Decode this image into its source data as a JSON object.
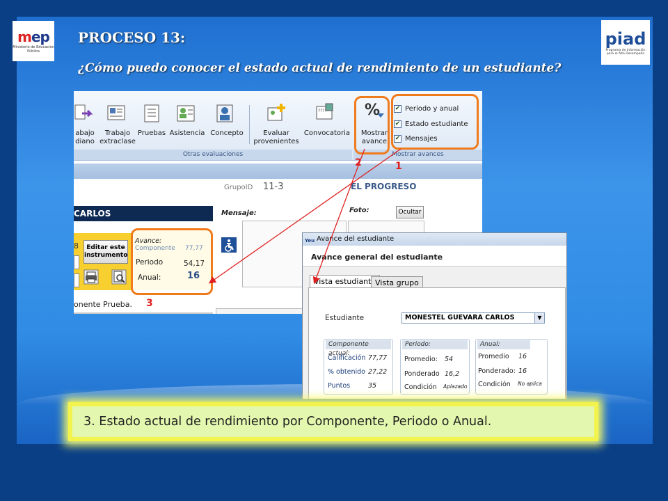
{
  "header": {
    "title": "PROCESO 13:",
    "subtitle": "¿Cómo  puedo conocer el estado actual de rendimiento  de un estudiante?"
  },
  "logos": {
    "mep": {
      "text_a": "m",
      "text_b": "e",
      "text_c": "p",
      "caption": "Ministerio de Educación Pública"
    },
    "piad": {
      "text": "piad",
      "caption": "Programa de Información para el Alto Desempeño"
    }
  },
  "ribbon": {
    "buttons": [
      {
        "label": "abajo\ndiano"
      },
      {
        "label": "Trabajo\nextraclase"
      },
      {
        "label": "Pruebas"
      },
      {
        "label": "Asistencia"
      },
      {
        "label": "Concepto"
      },
      {
        "label": "Evaluar\nprovenientes"
      },
      {
        "label": "Convocatoria"
      },
      {
        "label": "Mostrar\navance"
      }
    ],
    "groups": {
      "otras": "Otras evaluaciones",
      "mostrar": "Mostrar avances"
    },
    "checkboxes": [
      {
        "label": "Periodo y anual",
        "checked": true
      },
      {
        "label": "Estado estudiante",
        "checked": true
      },
      {
        "label": "Mensajes",
        "checked": true
      }
    ]
  },
  "markers": {
    "m1": "1",
    "m2": "2",
    "m3": "3"
  },
  "form": {
    "grupo_label": "GrupoID",
    "grupo_value": "11-3",
    "school": "EL PROGRESO",
    "student_bar": "CARLOS",
    "mensaje_label": "Mensaje:",
    "foto_label": "Foto:",
    "ocultar": "Ocultar",
    "edit_button": "Editar este instrumento",
    "field_digit": "8",
    "avance_label": "Avance:",
    "componente_label": "Componente",
    "componente_value": "77,77",
    "periodo_label": "Periodo",
    "periodo_value": "54,17",
    "anual_label": "Anual:",
    "anual_value": "16",
    "footer_text": "onente Prueba."
  },
  "popup": {
    "window_title": "Avance del estudiante",
    "heading": "Avance general del estudiante",
    "tabs": [
      "Vista estudiante",
      "Vista grupo"
    ],
    "student_label": "Estudiante",
    "student_value": "MONESTEL GUEVARA CARLOS",
    "componente": {
      "title": "Componente actual:",
      "rows": [
        {
          "label": "Calificación",
          "value": "77,77"
        },
        {
          "label": "% obtenido",
          "value": "27,22"
        },
        {
          "label": "Puntos",
          "value": "35"
        }
      ]
    },
    "periodo": {
      "title": "Periodo:",
      "rows": [
        {
          "label": "Promedio:",
          "value": "54"
        },
        {
          "label": "Ponderado",
          "value": "16,2"
        },
        {
          "label": "Condición",
          "value": "Aplazado"
        }
      ]
    },
    "anual": {
      "title": "Anual:",
      "rows": [
        {
          "label": "Promedio",
          "value": "16"
        },
        {
          "label": "Ponderado:",
          "value": "16"
        },
        {
          "label": "Condición",
          "value": "No aplica"
        }
      ]
    }
  },
  "caption": "3. Estado actual de rendimiento por Componente, Periodo o Anual.",
  "colors": {
    "highlight": "#f07b1d",
    "marker": "#e02020",
    "caption_bg": "#e3f7ae"
  }
}
